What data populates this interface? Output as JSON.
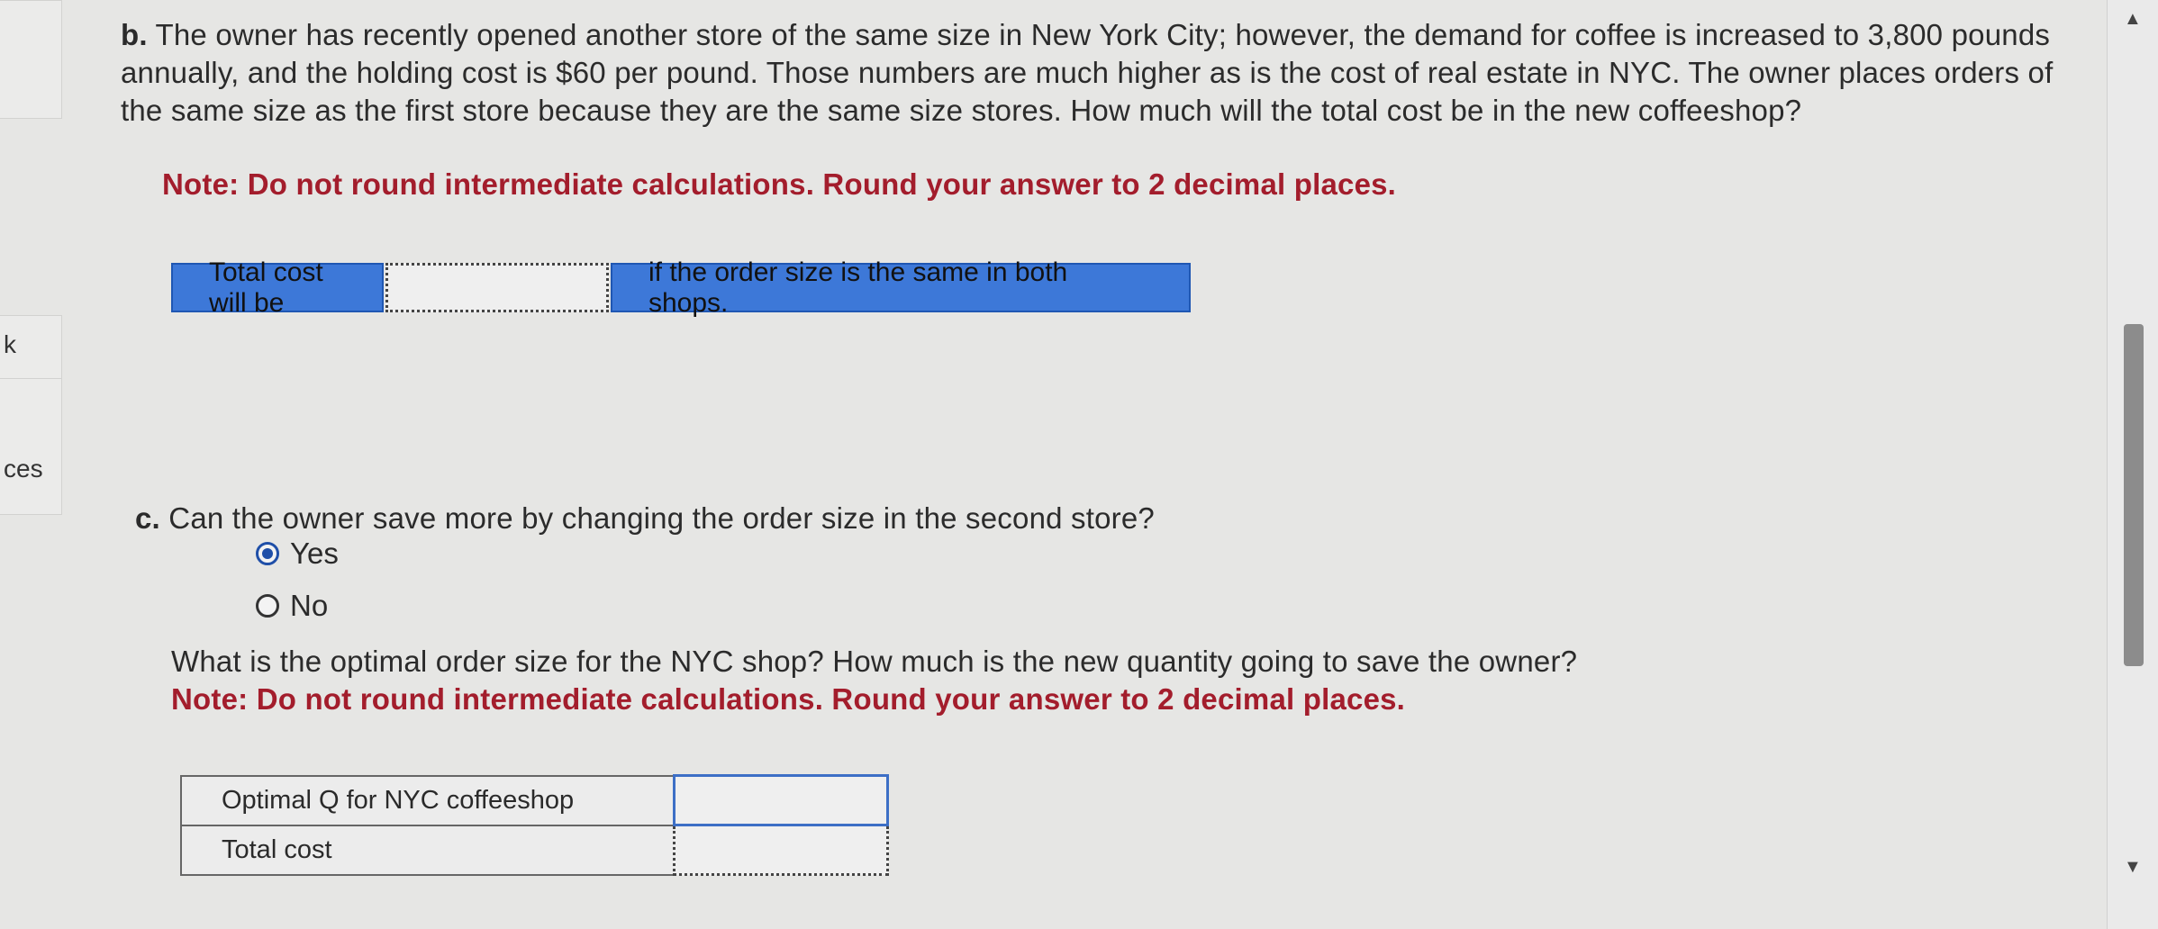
{
  "sidebar": {
    "item1_label": "k",
    "item2_label": "ces"
  },
  "part_b": {
    "label": "b.",
    "question": "The owner has recently opened another store of the same size in New York City; however, the demand for coffee is increased to 3,800 pounds annually, and the holding cost is $60 per pound. Those numbers are much higher as is the cost of real estate in NYC. The owner places orders of the same size as the first store because they are the same size stores. How much will the total cost be in the new coffeeshop?",
    "note": "Note: Do not round intermediate calculations. Round your answer to 2 decimal places.",
    "answer_prefix": "Total cost will be",
    "answer_value": "",
    "answer_suffix": "if the order size is the same in both shops."
  },
  "part_c": {
    "label": "c.",
    "question": "Can the owner save more by changing the order size in the second store?",
    "options": [
      {
        "label": "Yes",
        "selected": true
      },
      {
        "label": "No",
        "selected": false
      }
    ],
    "followup": "What is the optimal order size for the NYC shop? How much is the new quantity going to save the owner?",
    "note": "Note: Do not round intermediate calculations. Round your answer to 2 decimal places.",
    "table": [
      {
        "label": "Optimal Q for NYC coffeeshop",
        "value": ""
      },
      {
        "label": "Total cost",
        "value": ""
      }
    ]
  },
  "scrollbar": {
    "up_icon": "▲",
    "down_icon": "▼"
  }
}
